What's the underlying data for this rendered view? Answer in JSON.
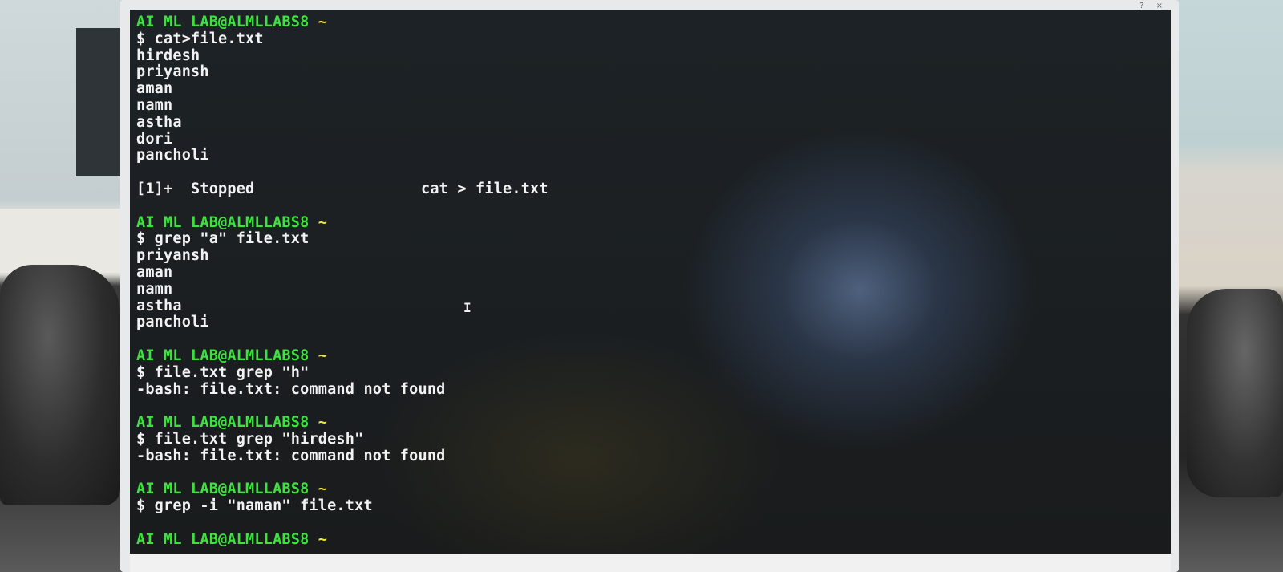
{
  "window": {
    "controls": [
      "?",
      "×"
    ]
  },
  "terminal": {
    "prompt_user": "AI ML LAB@ALMLLABS8",
    "prompt_dir": "~",
    "lines": [
      {
        "type": "prompt"
      },
      {
        "type": "cmd",
        "text": "$ cat>file.txt"
      },
      {
        "type": "out",
        "text": "hirdesh"
      },
      {
        "type": "out",
        "text": "priyansh"
      },
      {
        "type": "out",
        "text": "aman"
      },
      {
        "type": "out",
        "text": "namn"
      },
      {
        "type": "out",
        "text": "astha"
      },
      {
        "type": "out",
        "text": "dori"
      },
      {
        "type": "out",
        "text": "pancholi"
      },
      {
        "type": "blank"
      },
      {
        "type": "job",
        "text": "[1]+  Stopped",
        "cmd": "cat > file.txt"
      },
      {
        "type": "blank"
      },
      {
        "type": "prompt"
      },
      {
        "type": "cmd",
        "text": "$ grep \"a\" file.txt"
      },
      {
        "type": "out",
        "text": "priyansh"
      },
      {
        "type": "out",
        "text": "aman"
      },
      {
        "type": "out",
        "text": "namn"
      },
      {
        "type": "out",
        "text": "astha"
      },
      {
        "type": "out",
        "text": "pancholi"
      },
      {
        "type": "blank"
      },
      {
        "type": "prompt"
      },
      {
        "type": "cmd",
        "text": "$ file.txt grep \"h\""
      },
      {
        "type": "out",
        "text": "-bash: file.txt: command not found"
      },
      {
        "type": "blank"
      },
      {
        "type": "prompt"
      },
      {
        "type": "cmd",
        "text": "$ file.txt grep \"hirdesh\""
      },
      {
        "type": "out",
        "text": "-bash: file.txt: command not found"
      },
      {
        "type": "blank"
      },
      {
        "type": "prompt"
      },
      {
        "type": "cmd",
        "text": "$ grep -i \"naman\" file.txt"
      },
      {
        "type": "blank"
      },
      {
        "type": "prompt"
      }
    ],
    "cursor_glyph": "I"
  }
}
